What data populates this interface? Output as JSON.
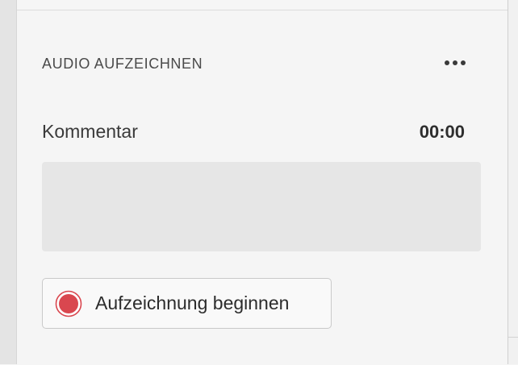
{
  "panel": {
    "section_title": "AUDIO AUFZEICHNEN",
    "more_icon": "more-horizontal-icon",
    "comment_label": "Kommentar",
    "timer": "00:00",
    "comment_value": "",
    "record_button_label": "Aufzeichnung beginnen",
    "record_icon": "record-icon",
    "colors": {
      "background": "#f5f5f5",
      "comment_box": "#e6e6e6",
      "record_dot": "#d9474f"
    }
  }
}
